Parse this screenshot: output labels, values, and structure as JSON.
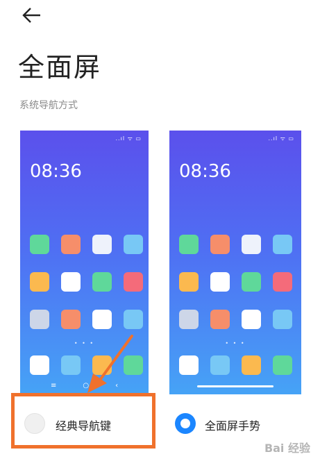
{
  "header": {
    "back_icon": "arrow-left-icon",
    "title": "全面屏"
  },
  "section": {
    "subtitle": "系统导航方式"
  },
  "phones": {
    "classic": {
      "clock": "08:36",
      "status": "..ıl ᯤ ▭",
      "dots": "• • •",
      "nav_icons": [
        "≡",
        "○",
        "‹"
      ],
      "apps": [
        "#5fd89a",
        "#f68e6a",
        "#eef2fb",
        "#78c8f5",
        "#fbb94f",
        "#ffffff",
        "#5fd89a",
        "#f46b7a",
        "#cdd6e8",
        "#f68e6a",
        "#ffffff",
        "#78c8f5"
      ],
      "dock": [
        "#ffffff",
        "#78c8f5",
        "#fbb94f",
        "#5fd89a"
      ]
    },
    "gesture": {
      "clock": "08:36",
      "status": "..ıl ᯤ ▭",
      "dots": "• • •",
      "apps": [
        "#5fd89a",
        "#f68e6a",
        "#eef2fb",
        "#78c8f5",
        "#fbb94f",
        "#ffffff",
        "#5fd89a",
        "#f46b7a",
        "#cdd6e8",
        "#f68e6a",
        "#ffffff",
        "#78c8f5"
      ],
      "dock": [
        "#ffffff",
        "#78c8f5",
        "#fbb94f",
        "#5fd89a"
      ]
    }
  },
  "options": {
    "classic_label": "经典导航键",
    "classic_selected": false,
    "gesture_label": "全面屏手势",
    "gesture_selected": true
  },
  "annotation": {
    "highlight_color": "#f0712c",
    "accent": "#1b86ff"
  },
  "watermark": "Bai 经验"
}
